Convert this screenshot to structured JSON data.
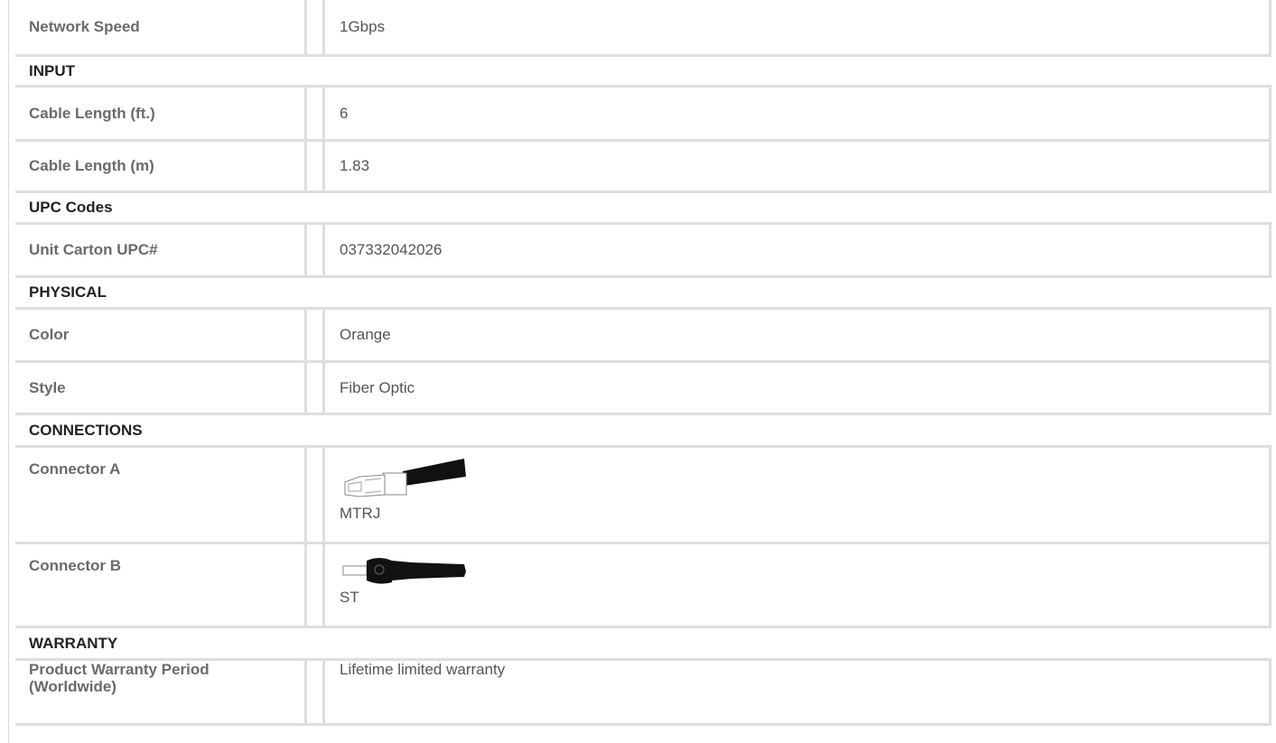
{
  "rows": [
    {
      "type": "spec",
      "label": "Network Speed",
      "value": "1Gbps"
    },
    {
      "type": "section",
      "label": "INPUT"
    },
    {
      "type": "spec",
      "label": "Cable Length (ft.)",
      "value": "6"
    },
    {
      "type": "spec",
      "label": "Cable Length (m)",
      "value": "1.83"
    },
    {
      "type": "section",
      "label": "UPC Codes"
    },
    {
      "type": "spec",
      "label": "Unit Carton UPC#",
      "value": "037332042026"
    },
    {
      "type": "section",
      "label": "PHYSICAL"
    },
    {
      "type": "spec",
      "label": "Color",
      "value": "Orange"
    },
    {
      "type": "spec",
      "label": "Style",
      "value": "Fiber Optic"
    },
    {
      "type": "section",
      "label": "CONNECTIONS"
    },
    {
      "type": "spec",
      "label": "Connector A",
      "value": "MTRJ",
      "icon": "mtrj-connector-icon"
    },
    {
      "type": "spec",
      "label": "Connector B",
      "value": "ST",
      "icon": "st-connector-icon"
    },
    {
      "type": "section",
      "label": "WARRANTY"
    },
    {
      "type": "spec",
      "label": "Product Warranty Period (Worldwide)",
      "value": "Lifetime limited warranty"
    }
  ]
}
